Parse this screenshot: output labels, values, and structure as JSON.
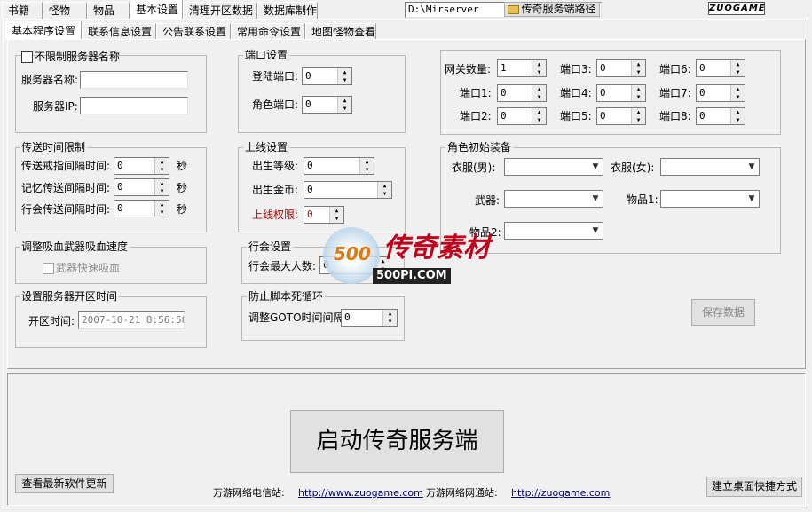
{
  "top_tabs": [
    "书籍",
    "怪物",
    "物品",
    "基本设置",
    "清理开区数据",
    "数据库制作"
  ],
  "path": {
    "value": "D:\\Mirserver",
    "button": "传奇服务端路径",
    "folder_icon": "folder-icon"
  },
  "logo_text": "ZUOGAME",
  "sub_tabs": [
    "基本程序设置",
    "联系信息设置",
    "公告联系设置",
    "常用命令设置",
    "地图怪物查看"
  ],
  "server": {
    "checkbox_label": "不限制服务器名称",
    "name_label": "服务器名称:",
    "name_value": "",
    "ip_label": "服务器IP:",
    "ip_value": ""
  },
  "ports": {
    "title": "端口设置",
    "login_label": "登陆端口:",
    "login_value": "0",
    "char_label": "角色端口:",
    "char_value": "0"
  },
  "gateway": {
    "count_label": "网关数量:",
    "count_value": "1",
    "port_labels": [
      "端口1:",
      "端口2:",
      "端口3:",
      "端口4:",
      "端口5:",
      "端口6:",
      "端口7:",
      "端口8:"
    ],
    "port_values": [
      "0",
      "0",
      "0",
      "0",
      "0",
      "0",
      "0",
      "0"
    ]
  },
  "teleport": {
    "title": "传送时间限制",
    "rows": [
      {
        "label": "传送戒指间隔时间:",
        "value": "0",
        "unit": "秒"
      },
      {
        "label": "记忆传送间隔时间:",
        "value": "0",
        "unit": "秒"
      },
      {
        "label": "行会传送间隔时间:",
        "value": "0",
        "unit": "秒"
      }
    ]
  },
  "online": {
    "title": "上线设置",
    "level_label": "出生等级:",
    "level_value": "0",
    "gold_label": "出生金币:",
    "gold_value": "0",
    "perm_label": "上线权限:",
    "perm_value": "0"
  },
  "equip": {
    "title": "角色初始装备",
    "male_label": "衣服(男):",
    "female_label": "衣服(女):",
    "weapon_label": "武器:",
    "item1_label": "物品1:",
    "item2_label": "物品2:"
  },
  "leech": {
    "title": "调整吸血武器吸血速度",
    "checkbox_label": "武器快速吸血"
  },
  "guild": {
    "title": "行会设置",
    "max_label": "行会最大人数:",
    "max_value": "0"
  },
  "open_time": {
    "title": "设置服务器开区时间",
    "label": "开区时间:",
    "value": "2007-10-21 8:56:58"
  },
  "script": {
    "title": "防止脚本死循环",
    "label": "调整GOTO时间间隔:",
    "value": "0"
  },
  "save_button": "保存数据",
  "start_button": "启动传奇服务端",
  "update_button": "查看最新软件更新",
  "shortcut_button": "建立桌面快捷方式",
  "telecom_label": "万游网络电信站:",
  "telecom_url": "http://www.zuogame.com",
  "netcom_label": "万游网络网通站:",
  "netcom_url": "http://zuogame.com",
  "watermark": {
    "main": "传奇素材",
    "sub": "500Pi.COM",
    "badge": "500"
  },
  "colors": {
    "perm_label": "#c00000",
    "watermark": "#c0001a"
  }
}
